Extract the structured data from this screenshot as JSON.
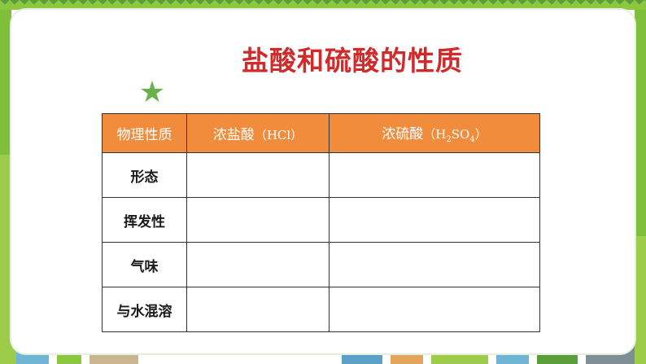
{
  "title": "盐酸和硫酸的性质",
  "star_icon": "star-icon",
  "table": {
    "headers": {
      "col1": "物理性质",
      "col2_text": "浓盐酸",
      "col2_formula": "（HCl）",
      "col3_text": "浓硫酸",
      "col3_formula_open": "（H",
      "col3_sub1": "2",
      "col3_mid": "SO",
      "col3_sub2": "4",
      "col3_close": "）"
    },
    "rows": [
      {
        "label": "形态",
        "hcl": "",
        "h2so4": ""
      },
      {
        "label": "挥发性",
        "hcl": "",
        "h2so4": ""
      },
      {
        "label": "气味",
        "hcl": "",
        "h2so4": ""
      },
      {
        "label": "与水混溶",
        "hcl": "",
        "h2so4": ""
      }
    ]
  },
  "colors": {
    "title": "#d02a2a",
    "header_bg": "#f08c3c",
    "star": "#6ab04c",
    "border_green": "#8dc63f"
  }
}
